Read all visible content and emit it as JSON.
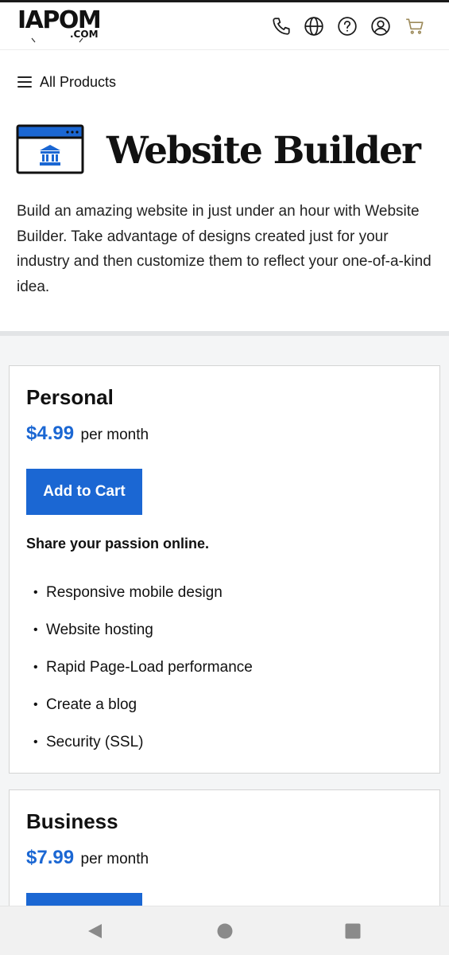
{
  "header": {
    "logo": {
      "main": "IAPOM",
      "sub": ".COM"
    },
    "icons": [
      "phone-icon",
      "globe-icon",
      "help-icon",
      "account-icon",
      "cart-icon"
    ]
  },
  "breadcrumb": {
    "label": "All Products"
  },
  "hero": {
    "title": "Website Builder",
    "description": "Build an amazing website in just under an hour with Website Builder. Take advantage of designs created just for your industry and then customize them to reflect your one-of-a-kind idea."
  },
  "plans": [
    {
      "name": "Personal",
      "price": "$4.99",
      "period": "per month",
      "cta": "Add to Cart",
      "tagline": "Share your passion online.",
      "features": [
        "Responsive mobile design",
        "Website hosting",
        "Rapid Page-Load performance",
        "Create a blog",
        "Security (SSL)"
      ]
    },
    {
      "name": "Business",
      "price": "$7.99",
      "period": "per month"
    }
  ],
  "colors": {
    "accent": "#1b67d3",
    "text": "#111111",
    "background_alt": "#f4f5f6"
  },
  "system_nav": [
    "back-icon",
    "home-icon",
    "recents-icon"
  ]
}
